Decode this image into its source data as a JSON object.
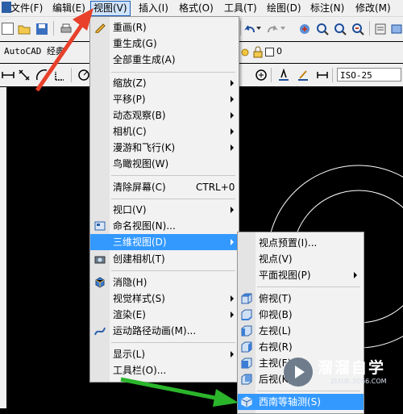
{
  "menubar": {
    "items": [
      {
        "label": "文件(F)"
      },
      {
        "label": "编辑(E)"
      },
      {
        "label": "视图(V)"
      },
      {
        "label": "插入(I)"
      },
      {
        "label": "格式(O)"
      },
      {
        "label": "工具(T)"
      },
      {
        "label": "绘图(D)"
      },
      {
        "label": "标注(N)"
      },
      {
        "label": "修改(M)"
      }
    ]
  },
  "toolbar2": {
    "workspace": "AutoCAD 经典",
    "layer_value": "0"
  },
  "toolbar3": {
    "dimstyle": "ISO-25"
  },
  "view_menu": {
    "items": [
      {
        "label": "重画(R)"
      },
      {
        "label": "重生成(G)"
      },
      {
        "label": "全部重生成(A)"
      },
      {
        "label": "缩放(Z)"
      },
      {
        "label": "平移(P)"
      },
      {
        "label": "动态观察(B)"
      },
      {
        "label": "相机(C)"
      },
      {
        "label": "漫游和飞行(K)"
      },
      {
        "label": "鸟瞰视图(W)"
      },
      {
        "label": "清除屏幕(C)",
        "shortcut": "CTRL+0"
      },
      {
        "label": "视口(V)"
      },
      {
        "label": "命名视图(N)..."
      },
      {
        "label": "三维视图(D)"
      },
      {
        "label": "创建相机(T)"
      },
      {
        "label": "消隐(H)"
      },
      {
        "label": "视觉样式(S)"
      },
      {
        "label": "渲染(E)"
      },
      {
        "label": "运动路径动画(M)..."
      },
      {
        "label": "显示(L)"
      },
      {
        "label": "工具栏(O)..."
      }
    ]
  },
  "view3d_menu": {
    "items": [
      {
        "label": "视点预置(I)..."
      },
      {
        "label": "视点(V)"
      },
      {
        "label": "平面视图(P)"
      },
      {
        "label": "俯视(T)"
      },
      {
        "label": "仰视(B)"
      },
      {
        "label": "左视(L)"
      },
      {
        "label": "右视(R)"
      },
      {
        "label": "主视(F)"
      },
      {
        "label": "后视(K)"
      },
      {
        "label": "西南等轴测(S)"
      }
    ]
  },
  "watermark": {
    "title": "溜溜自学",
    "url": "ZIXUE.3D66.COM"
  },
  "colors": {
    "highlight": "#3399ff",
    "arrow_red": "#e8402a",
    "arrow_green": "#2bb52b",
    "canvas": "#000000"
  }
}
